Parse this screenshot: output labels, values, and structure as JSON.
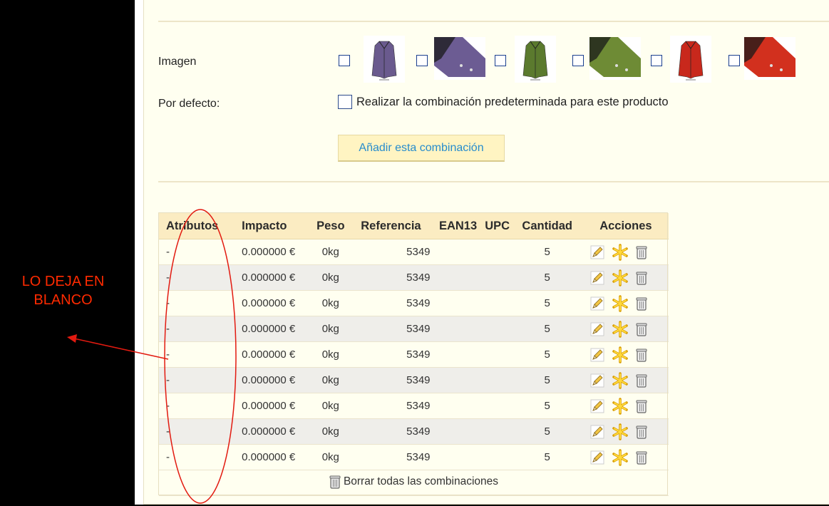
{
  "annotation": {
    "line1": "LO DEJA EN",
    "line2": "BLANCO",
    "color": "#ff2a00"
  },
  "form": {
    "image_label": "Imagen",
    "default_label": "Por defecto:",
    "default_checkbox_text": "Realizar la combinación predeterminada para este producto",
    "add_button": "Añadir esta combinación",
    "images": [
      {
        "name": "purple-jacket-front",
        "color": "#6a5a8e"
      },
      {
        "name": "purple-jacket-detail",
        "color": "#6c5c93"
      },
      {
        "name": "green-jacket-front",
        "color": "#5b7a2e"
      },
      {
        "name": "green-jacket-detail",
        "color": "#6e8b35"
      },
      {
        "name": "red-jacket-front",
        "color": "#c8281c"
      },
      {
        "name": "red-jacket-detail",
        "color": "#d2301e"
      }
    ]
  },
  "table": {
    "headers": [
      "Atributos",
      "Impacto",
      "Peso",
      "Referencia",
      "EAN13",
      "UPC",
      "Cantidad",
      "Acciones"
    ],
    "rows": [
      {
        "attr": "-",
        "impact": "0.000000 €",
        "weight": "0kg",
        "ref": "5349",
        "ean13": "",
        "upc": "",
        "qty": "5"
      },
      {
        "attr": "-",
        "impact": "0.000000 €",
        "weight": "0kg",
        "ref": "5349",
        "ean13": "",
        "upc": "",
        "qty": "5"
      },
      {
        "attr": "-",
        "impact": "0.000000 €",
        "weight": "0kg",
        "ref": "5349",
        "ean13": "",
        "upc": "",
        "qty": "5"
      },
      {
        "attr": "-",
        "impact": "0.000000 €",
        "weight": "0kg",
        "ref": "5349",
        "ean13": "",
        "upc": "",
        "qty": "5"
      },
      {
        "attr": "-",
        "impact": "0.000000 €",
        "weight": "0kg",
        "ref": "5349",
        "ean13": "",
        "upc": "",
        "qty": "5"
      },
      {
        "attr": "-",
        "impact": "0.000000 €",
        "weight": "0kg",
        "ref": "5349",
        "ean13": "",
        "upc": "",
        "qty": "5"
      },
      {
        "attr": "-",
        "impact": "0.000000 €",
        "weight": "0kg",
        "ref": "5349",
        "ean13": "",
        "upc": "",
        "qty": "5"
      },
      {
        "attr": "-",
        "impact": "0.000000 €",
        "weight": "0kg",
        "ref": "5349",
        "ean13": "",
        "upc": "",
        "qty": "5"
      },
      {
        "attr": "-",
        "impact": "0.000000 €",
        "weight": "0kg",
        "ref": "5349",
        "ean13": "",
        "upc": "",
        "qty": "5"
      }
    ],
    "action_icons": [
      "edit-pencil-icon",
      "default-star-icon",
      "delete-trash-icon"
    ],
    "delete_all": "Borrar todas las combinaciones"
  }
}
